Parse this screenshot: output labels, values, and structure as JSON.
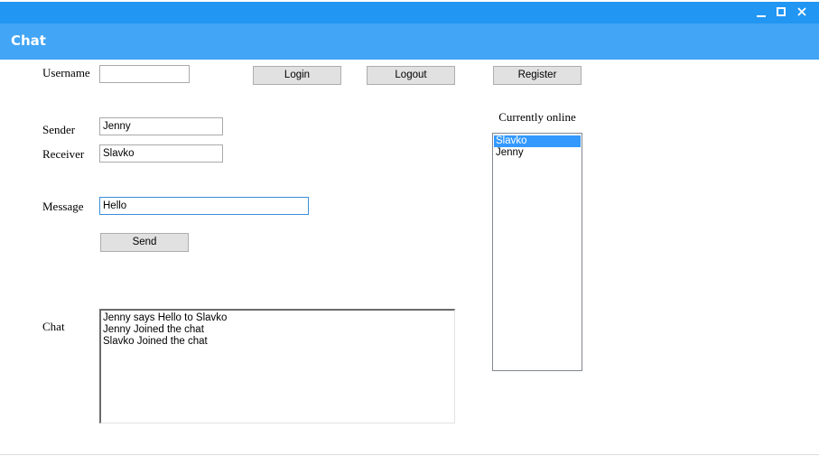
{
  "window": {
    "title": "Chat",
    "controls": [
      "minimize-icon",
      "maximize-icon",
      "close-icon"
    ]
  },
  "form": {
    "username_label": "Username",
    "username_value": "",
    "login_label": "Login",
    "logout_label": "Logout",
    "register_label": "Register",
    "sender_label": "Sender",
    "sender_value": "Jenny",
    "receiver_label": "Receiver",
    "receiver_value": "Slavko",
    "message_label": "Message",
    "message_value": "Hello",
    "send_label": "Send",
    "chat_label": "Chat"
  },
  "chat": {
    "lines": [
      "Jenny says Hello to Slavko",
      "Jenny Joined the chat",
      "Slavko Joined the chat"
    ]
  },
  "online": {
    "title": "Currently online",
    "users": [
      "Slavko",
      "Jenny"
    ],
    "selected": "Slavko"
  },
  "colors": {
    "titlebar": "#2196f3",
    "appbar": "#42a5f5",
    "selection": "#3399ff"
  }
}
